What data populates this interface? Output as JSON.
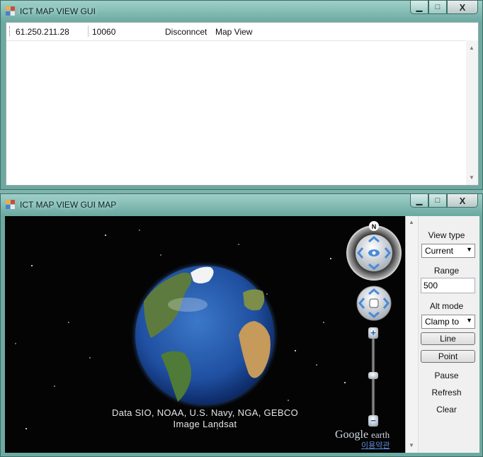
{
  "window_main": {
    "title": "ICT MAP VIEW GUI",
    "row": {
      "ip": "61.250.211.28",
      "port": "10060",
      "disconnect": "Disconncet",
      "map_view": "Map View"
    }
  },
  "window_map": {
    "title": "ICT MAP VIEW GUI MAP",
    "compass_north": "N",
    "attribution_line1": "Data SIO, NOAA, U.S. Navy, NGA, GEBCO",
    "attribution_line2": "Image Landsat",
    "logo_google": "Google",
    "logo_earth": "earth",
    "terms_link": "이용약관"
  },
  "panel": {
    "view_type_label": "View type",
    "view_type_value": "Current",
    "range_label": "Range",
    "range_value": "500",
    "alt_mode_label": "Alt mode",
    "alt_mode_value": "Clamp to",
    "line_button": "Line",
    "point_button": "Point",
    "pause": "Pause",
    "refresh": "Refresh",
    "clear": "Clear"
  },
  "window_controls": {
    "minimize": "▁",
    "maximize": "□",
    "close": "X"
  },
  "colors": {
    "titlebar": "#6ca9a1",
    "space": "#040405",
    "ocean": "#1f4fa0"
  }
}
